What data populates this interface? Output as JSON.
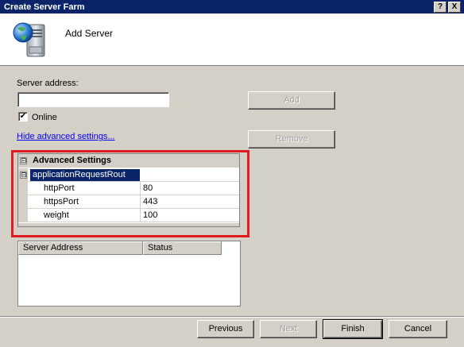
{
  "window": {
    "title": "Create Server Farm",
    "help_glyph": "?",
    "close_glyph": "X"
  },
  "header": {
    "heading": "Add Server",
    "icon": "server-globe-icon"
  },
  "form": {
    "server_address_label": "Server address:",
    "server_address_value": "",
    "add_label": "Add",
    "online_label": "Online",
    "online_checked": true,
    "online_check_glyph": "✔",
    "hide_advanced_link": "Hide advanced settings...",
    "remove_label": "Remove"
  },
  "property_grid": {
    "category": "Advanced Settings",
    "category_glyph": "⊟",
    "group": "applicationRequestRout",
    "group_glyph": "⊟",
    "properties": [
      {
        "name": "httpPort",
        "value": "80"
      },
      {
        "name": "httpsPort",
        "value": "443"
      },
      {
        "name": "weight",
        "value": "100"
      }
    ]
  },
  "server_list": {
    "columns": [
      "Server Address",
      "Status"
    ],
    "rows": []
  },
  "footer": {
    "previous_label": "Previous",
    "next_label": "Next",
    "finish_label": "Finish",
    "cancel_label": "Cancel"
  },
  "colors": {
    "titlebar": "#0a246a",
    "highlight_box": "#e01b22",
    "dialog": "#d4d0c8"
  }
}
